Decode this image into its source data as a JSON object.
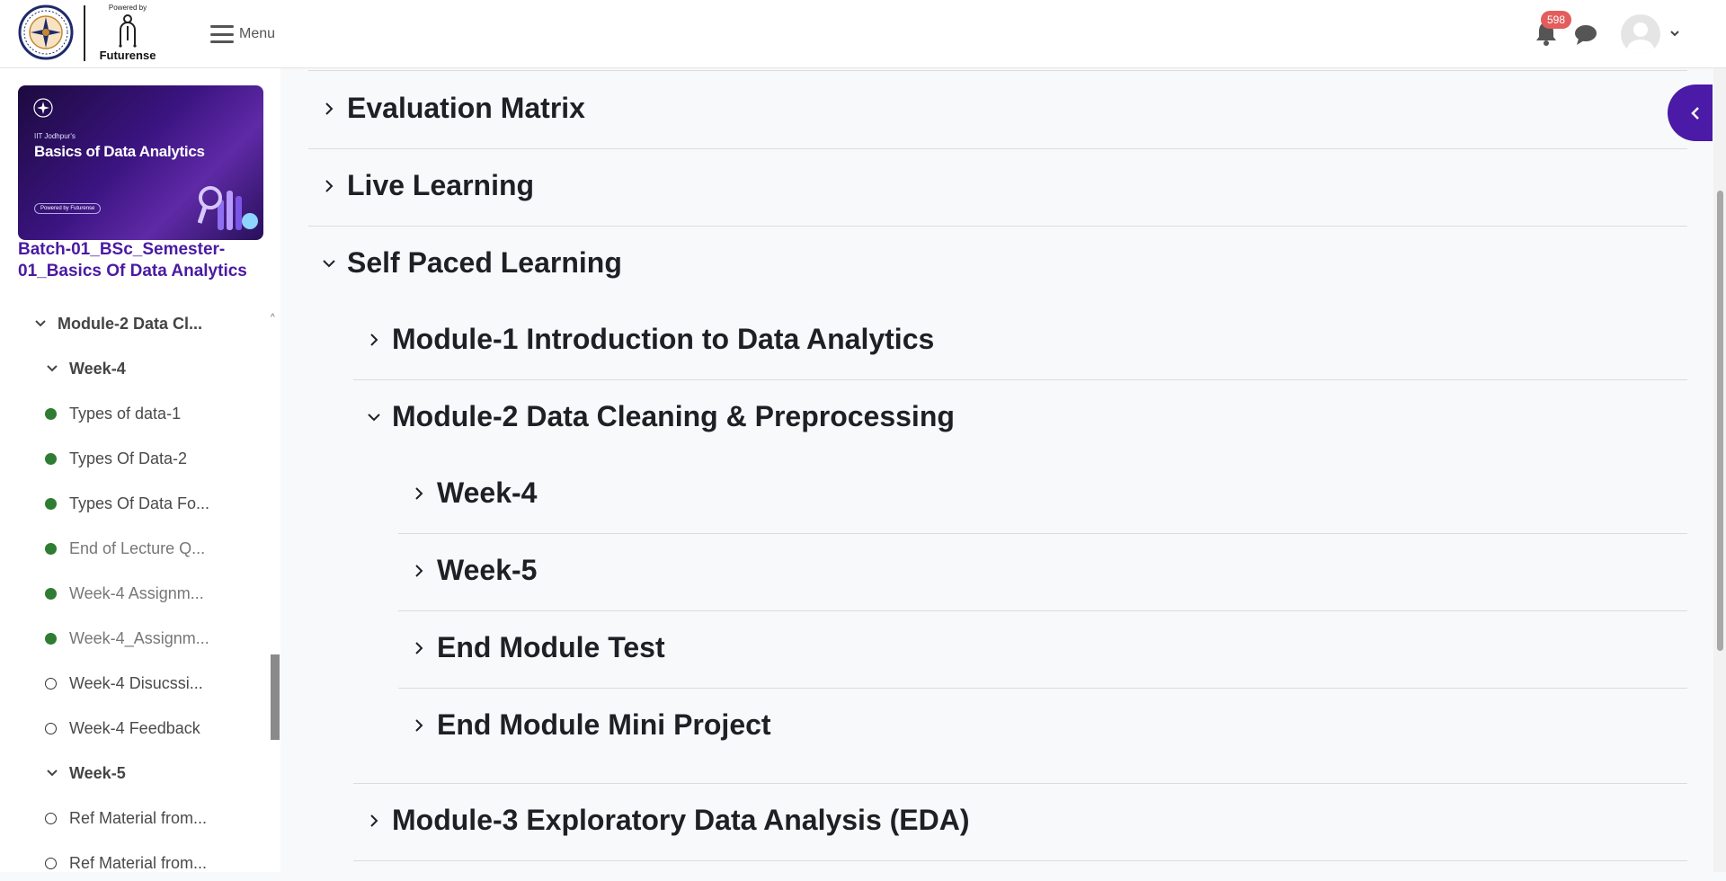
{
  "header": {
    "powered_by": "Powered by",
    "brand": "Futurense",
    "menu_label": "Menu",
    "notification_count": "598"
  },
  "course_card": {
    "kicker": "IIT Jodhpur's",
    "title": "Basics of Data Analytics",
    "pill": "Powered by Futurense"
  },
  "course_name": "Batch-01_BSc_Semester-01_Basics Of Data Analytics",
  "sidebar": {
    "items": [
      {
        "label": "Module-2 Data Cl...",
        "kind": "section",
        "icon": "chevron-down-icon"
      },
      {
        "label": "Week-4",
        "kind": "section",
        "icon": "chevron-down-icon"
      },
      {
        "label": "Types of data-1",
        "kind": "activity",
        "status": "done"
      },
      {
        "label": "Types Of Data-2",
        "kind": "activity",
        "status": "done"
      },
      {
        "label": "Types Of Data Fo...",
        "kind": "activity",
        "status": "done"
      },
      {
        "label": "End of Lecture Q...",
        "kind": "activity",
        "status": "done"
      },
      {
        "label": "Week-4 Assignm...",
        "kind": "activity",
        "status": "done"
      },
      {
        "label": "Week-4_Assignm...",
        "kind": "activity",
        "status": "done"
      },
      {
        "label": "Week-4 Disucssi...",
        "kind": "activity",
        "status": "todo"
      },
      {
        "label": "Week-4 Feedback",
        "kind": "activity",
        "status": "todo"
      },
      {
        "label": "Week-5",
        "kind": "section",
        "icon": "chevron-down-icon"
      },
      {
        "label": "Ref Material from...",
        "kind": "activity",
        "status": "todo"
      },
      {
        "label": "Ref Material from...",
        "kind": "activity",
        "status": "todo"
      }
    ]
  },
  "main": {
    "sections": [
      {
        "title": "Evaluation Matrix",
        "expanded": false
      },
      {
        "title": "Live Learning",
        "expanded": false
      },
      {
        "title": "Self Paced Learning",
        "expanded": true
      },
      {
        "title": "Module-1 Introduction to Data Analytics",
        "expanded": false
      },
      {
        "title": "Module-2 Data Cleaning & Preprocessing",
        "expanded": true
      },
      {
        "title": "Week-4",
        "expanded": false
      },
      {
        "title": "Week-5",
        "expanded": false
      },
      {
        "title": "End Module Test",
        "expanded": false
      },
      {
        "title": "End Module Mini Project",
        "expanded": false
      },
      {
        "title": "Module-3 Exploratory Data Analysis (EDA)",
        "expanded": false
      }
    ]
  },
  "colors": {
    "accent": "#4b1aa6",
    "done": "#2e7d32",
    "badge": "#e35d5d"
  }
}
